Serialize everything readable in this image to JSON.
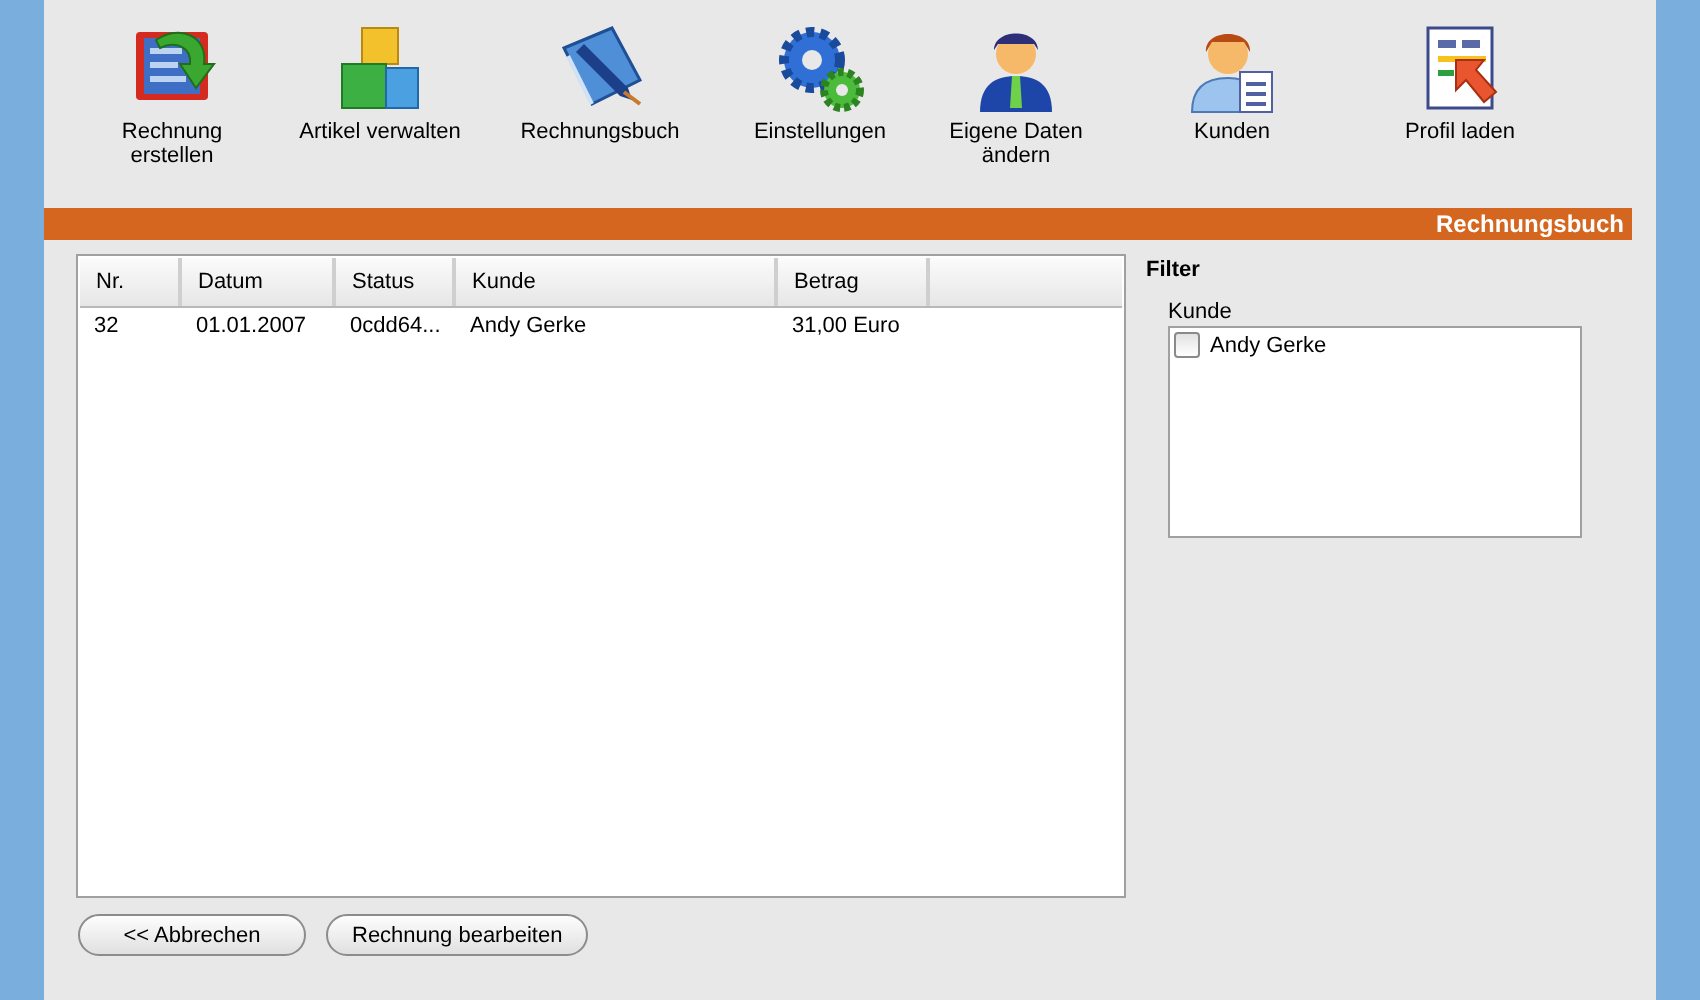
{
  "toolbar": [
    {
      "label": "Rechnung erstellen"
    },
    {
      "label": "Artikel verwalten"
    },
    {
      "label": "Rechnungsbuch"
    },
    {
      "label": "Einstellungen"
    },
    {
      "label": "Eigene Daten ändern"
    },
    {
      "label": "Kunden"
    },
    {
      "label": "Profil laden"
    }
  ],
  "section_title": "Rechnungsbuch",
  "table": {
    "columns": [
      "Nr.",
      "Datum",
      "Status",
      "Kunde",
      "Betrag"
    ],
    "rows": [
      [
        "32",
        "01.01.2007",
        "0cdd64...",
        "Andy Gerke",
        "31,00 Euro"
      ]
    ]
  },
  "filter": {
    "title": "Filter",
    "label": "Kunde",
    "items": [
      {
        "label": "Andy Gerke",
        "checked": false
      }
    ]
  },
  "buttons": [
    "<< Abbrechen",
    "Rechnung bearbeiten"
  ]
}
